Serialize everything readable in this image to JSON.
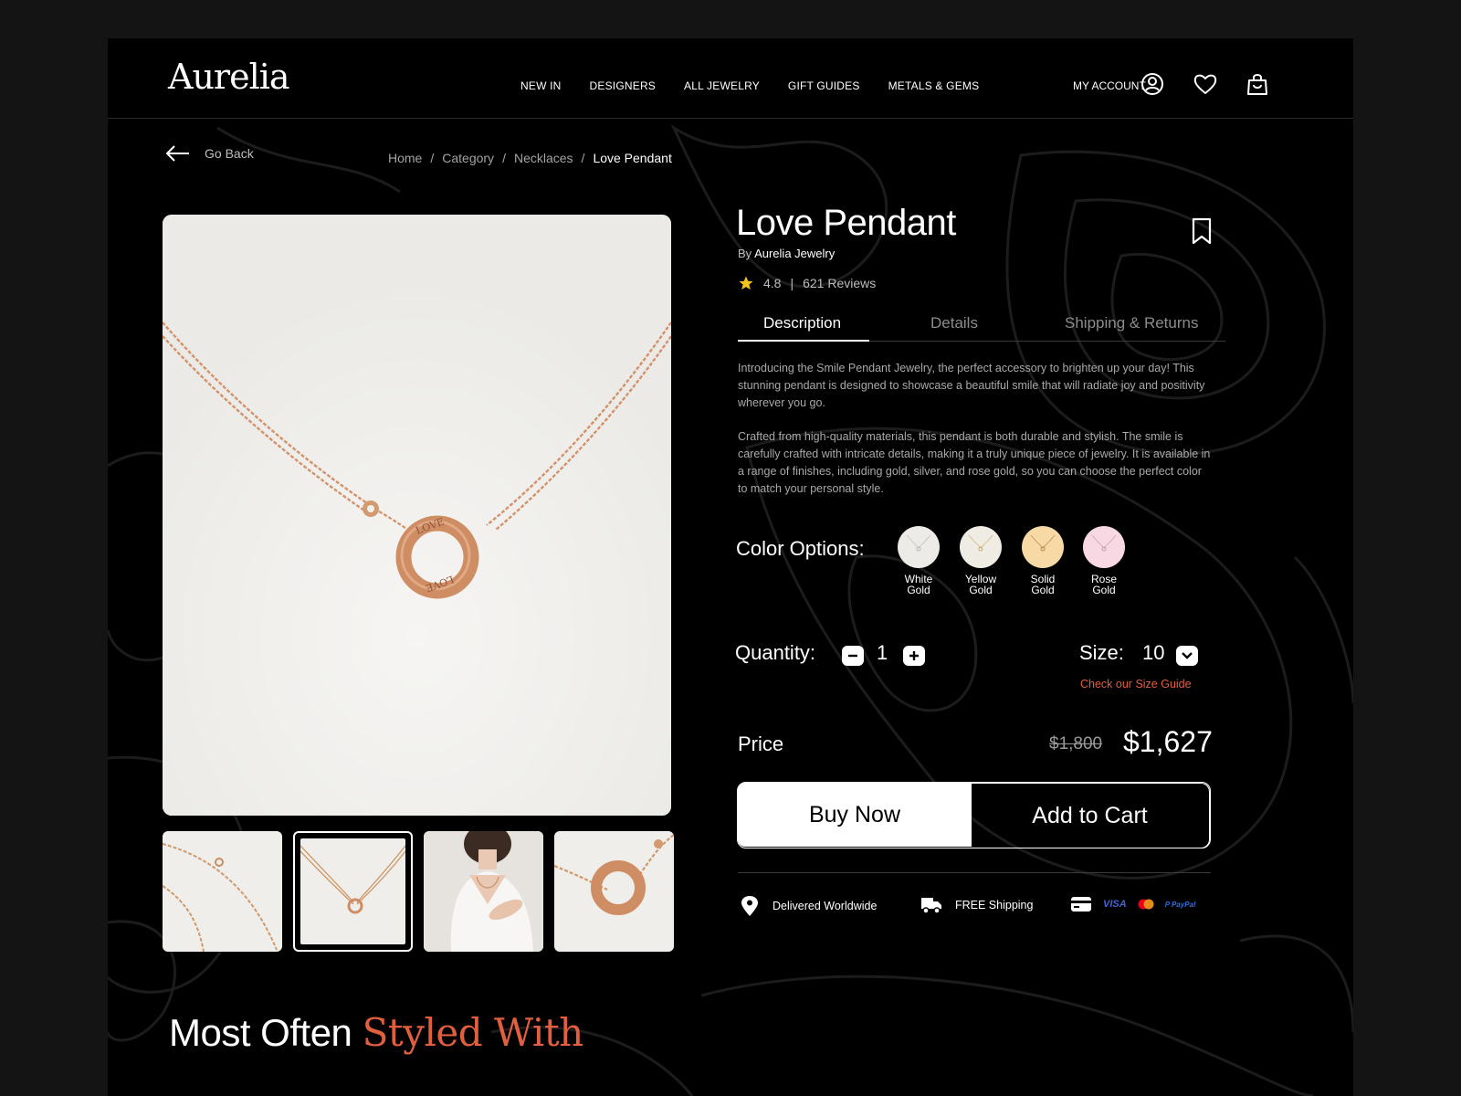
{
  "header": {
    "logo": "Aurelia",
    "nav": [
      "NEW IN",
      "DESIGNERS",
      "ALL JEWELRY",
      "GIFT GUIDES",
      "METALS & GEMS"
    ],
    "account": "MY ACCOUNT"
  },
  "back": "Go Back",
  "breadcrumbs": [
    "Home",
    "Category",
    "Necklaces",
    "Love Pendant"
  ],
  "product": {
    "title": "Love Pendant",
    "by_prefix": "By",
    "brand": "Aurelia Jewelry",
    "rating": "4.8",
    "reviews": "621 Reviews",
    "tabs": [
      "Description",
      "Details",
      "Shipping & Returns"
    ],
    "description": [
      "Introducing the Smile Pendant Jewelry, the perfect accessory to brighten up your day! This stunning pendant is designed to showcase a beautiful smile that will radiate joy and positivity wherever you go.",
      "Crafted from high-quality materials, this pendant is both durable and stylish. The smile is carefully crafted with intricate details, making it a truly unique piece of jewelry. It is available in a range of finishes, including gold, silver, and rose gold, so you can choose the perfect color to match your personal style."
    ],
    "color_label": "Color Options:",
    "colors": [
      {
        "line1": "White",
        "line2": "Gold",
        "hex": "#ecebe8"
      },
      {
        "line1": "Yellow",
        "line2": "Gold",
        "hex": "#efece4"
      },
      {
        "line1": "Solid",
        "line2": "Gold",
        "hex": "#f7d9a6"
      },
      {
        "line1": "Rose",
        "line2": "Gold",
        "hex": "#f8d8e2"
      }
    ],
    "quantity_label": "Quantity:",
    "quantity": "1",
    "size_label": "Size:",
    "size": "10",
    "size_guide": "Check our Size Guide",
    "price_label": "Price",
    "old_price": "$1,800",
    "price": "$1,627",
    "buy_now": "Buy Now",
    "add_to_cart": "Add to Cart"
  },
  "perks": {
    "delivery": "Delivered Worldwide",
    "shipping": "FREE Shipping",
    "visa": "VISA",
    "paypal": "PayPal"
  },
  "section": {
    "title_main": "Most Often",
    "title_accent": "Styled With"
  },
  "colors": {
    "accent": "#e15f3f",
    "background": "#000000",
    "star": "#f5c518"
  }
}
